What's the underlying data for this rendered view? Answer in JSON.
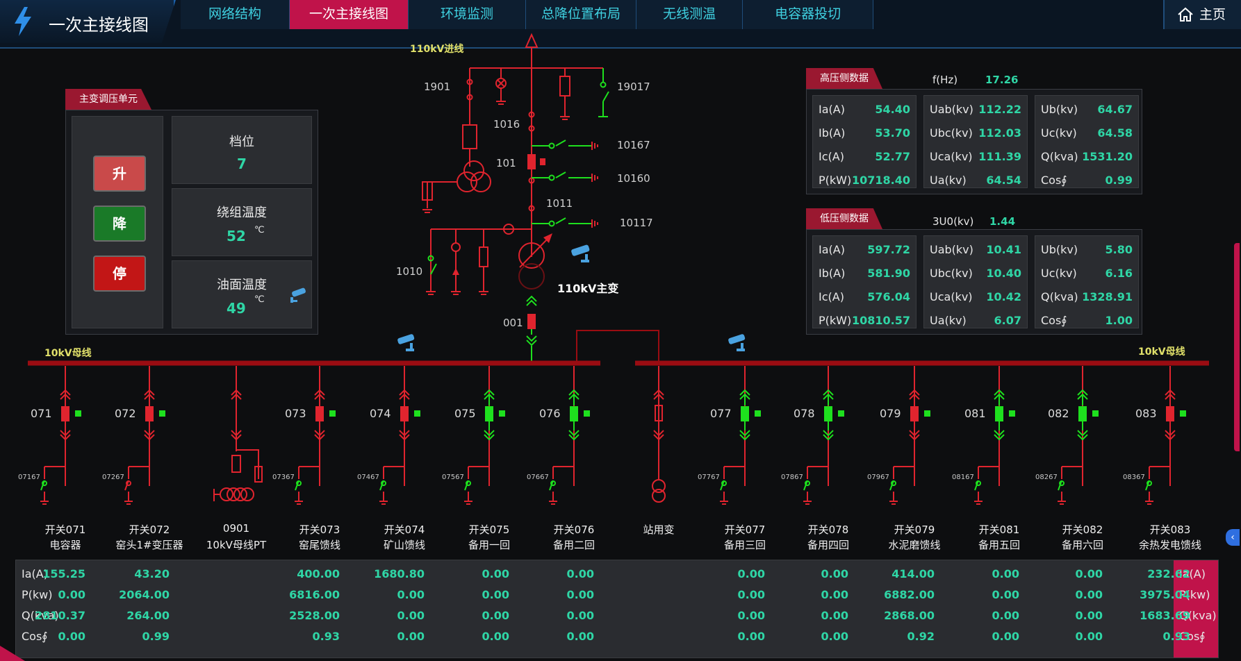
{
  "header": {
    "title": "一次主接线图",
    "tabs": [
      {
        "label": "网络结构"
      },
      {
        "label": "一次主接线图",
        "active": true
      },
      {
        "label": "环境监测"
      },
      {
        "label": "总降位置布局"
      },
      {
        "label": "无线测温"
      },
      {
        "label": "电容器投切"
      }
    ],
    "home_label": "主页"
  },
  "transformer_unit": {
    "title": "主变调压单元",
    "buttons": {
      "up": "升",
      "down": "降",
      "stop": "停"
    },
    "tap": {
      "label": "档位",
      "value": "7"
    },
    "winding_temp": {
      "label": "绕组温度",
      "value": "52",
      "unit": "℃"
    },
    "oil_temp": {
      "label": "油面温度",
      "value": "49",
      "unit": "℃"
    }
  },
  "hv_data": {
    "title": "高压侧数据",
    "freq_label": "f(Hz)",
    "freq_value": "17.26",
    "cols": [
      [
        {
          "k": "Ia(A)",
          "v": "54.40"
        },
        {
          "k": "Ib(A)",
          "v": "53.70"
        },
        {
          "k": "Ic(A)",
          "v": "52.77"
        },
        {
          "k": "P(kW)",
          "v": "10718.40"
        }
      ],
      [
        {
          "k": "Uab(kv)",
          "v": "112.22"
        },
        {
          "k": "Ubc(kv)",
          "v": "112.03"
        },
        {
          "k": "Uca(kv)",
          "v": "111.39"
        },
        {
          "k": "Ua(kv)",
          "v": "64.54"
        }
      ],
      [
        {
          "k": "Ub(kv)",
          "v": "64.67"
        },
        {
          "k": "Uc(kv)",
          "v": "64.58"
        },
        {
          "k": "Q(kva)",
          "v": "1531.20"
        },
        {
          "k": "Cos∮",
          "v": "0.99"
        }
      ]
    ]
  },
  "lv_data": {
    "title": "低压侧数据",
    "u0_label": "3U0(kv)",
    "u0_value": "1.44",
    "cols": [
      [
        {
          "k": "Ia(A)",
          "v": "597.72"
        },
        {
          "k": "Ib(A)",
          "v": "581.90"
        },
        {
          "k": "Ic(A)",
          "v": "576.04"
        },
        {
          "k": "P(kW)",
          "v": "10810.57"
        }
      ],
      [
        {
          "k": "Uab(kv)",
          "v": "10.41"
        },
        {
          "k": "Ubc(kv)",
          "v": "10.40"
        },
        {
          "k": "Uca(kv)",
          "v": "10.42"
        },
        {
          "k": "Ua(kv)",
          "v": "6.07"
        }
      ],
      [
        {
          "k": "Ub(kv)",
          "v": "5.80"
        },
        {
          "k": "Uc(kv)",
          "v": "6.16"
        },
        {
          "k": "Q(kva)",
          "v": "1328.91"
        },
        {
          "k": "Cos∮",
          "v": "1.00"
        }
      ]
    ]
  },
  "diagram": {
    "incoming_label": "110kV进线",
    "main_transformer_label": "110kV主变",
    "bus_left_label": "10kV母线",
    "bus_right_label": "10kV母线",
    "switch_labels": {
      "s1901": "1901",
      "s19017": "19017",
      "s1016": "1016",
      "s10167": "10167",
      "s101": "101",
      "s10160": "10160",
      "s1011": "1011",
      "s10117": "10117",
      "s1010": "1010",
      "s001": "001"
    }
  },
  "feeders": [
    {
      "num": "071",
      "small": "07167",
      "name1": "开关071",
      "name2": "电容器",
      "state": "red"
    },
    {
      "num": "072",
      "small": "07267",
      "name1": "开关072",
      "name2": "窑头1#变压器",
      "state": "red"
    },
    {
      "num": "",
      "small": "",
      "name1": "0901",
      "name2": "10kV母线PT",
      "state": "pt"
    },
    {
      "num": "073",
      "small": "07367",
      "name1": "开关073",
      "name2": "窑尾馈线",
      "state": "red"
    },
    {
      "num": "074",
      "small": "07467",
      "name1": "开关074",
      "name2": "矿山馈线",
      "state": "red"
    },
    {
      "num": "075",
      "small": "07567",
      "name1": "开关075",
      "name2": "备用一回",
      "state": "green"
    },
    {
      "num": "076",
      "small": "07667",
      "name1": "开关076",
      "name2": "备用二回",
      "state": "green"
    },
    {
      "num": "",
      "small": "",
      "name1": "站用变",
      "name2": "",
      "state": "station"
    },
    {
      "num": "077",
      "small": "07767",
      "name1": "开关077",
      "name2": "备用三回",
      "state": "green"
    },
    {
      "num": "078",
      "small": "07867",
      "name1": "开关078",
      "name2": "备用四回",
      "state": "green"
    },
    {
      "num": "079",
      "small": "07967",
      "name1": "开关079",
      "name2": "水泥磨馈线",
      "state": "red"
    },
    {
      "num": "081",
      "small": "08167",
      "name1": "开关081",
      "name2": "备用五回",
      "state": "green"
    },
    {
      "num": "082",
      "small": "08267",
      "name1": "开关082",
      "name2": "备用六回",
      "state": "green"
    },
    {
      "num": "083",
      "small": "08367",
      "name1": "开关083",
      "name2": "余热发电馈线",
      "state": "red"
    }
  ],
  "bottom_table": {
    "row_labels": [
      "Ia(A)",
      "P(kw)",
      "Q(kva)",
      "Cos∮"
    ],
    "columns": [
      [
        "155.25",
        "0.00",
        "2810.37",
        "0.00"
      ],
      [
        "43.20",
        "2064.00",
        "264.00",
        "0.99"
      ],
      [
        "",
        "",
        "",
        ""
      ],
      [
        "400.00",
        "6816.00",
        "2528.00",
        "0.93"
      ],
      [
        "1680.80",
        "0.00",
        "0.00",
        "0.00"
      ],
      [
        "0.00",
        "0.00",
        "0.00",
        "0.00"
      ],
      [
        "0.00",
        "0.00",
        "0.00",
        "0.00"
      ],
      [
        "",
        "",
        "",
        ""
      ],
      [
        "0.00",
        "0.00",
        "0.00",
        "0.00"
      ],
      [
        "0.00",
        "0.00",
        "0.00",
        "0.00"
      ],
      [
        "414.00",
        "6882.00",
        "2868.00",
        "0.92"
      ],
      [
        "0.00",
        "0.00",
        "0.00",
        "0.00"
      ],
      [
        "0.00",
        "0.00",
        "0.00",
        "0.00"
      ],
      [
        "232.62",
        "3975.04",
        "1683.69",
        "0.93"
      ]
    ]
  },
  "colors": {
    "red": "#e0242e",
    "green": "#1ee01e",
    "accent": "#c0134a",
    "value": "#2fd6a6"
  }
}
